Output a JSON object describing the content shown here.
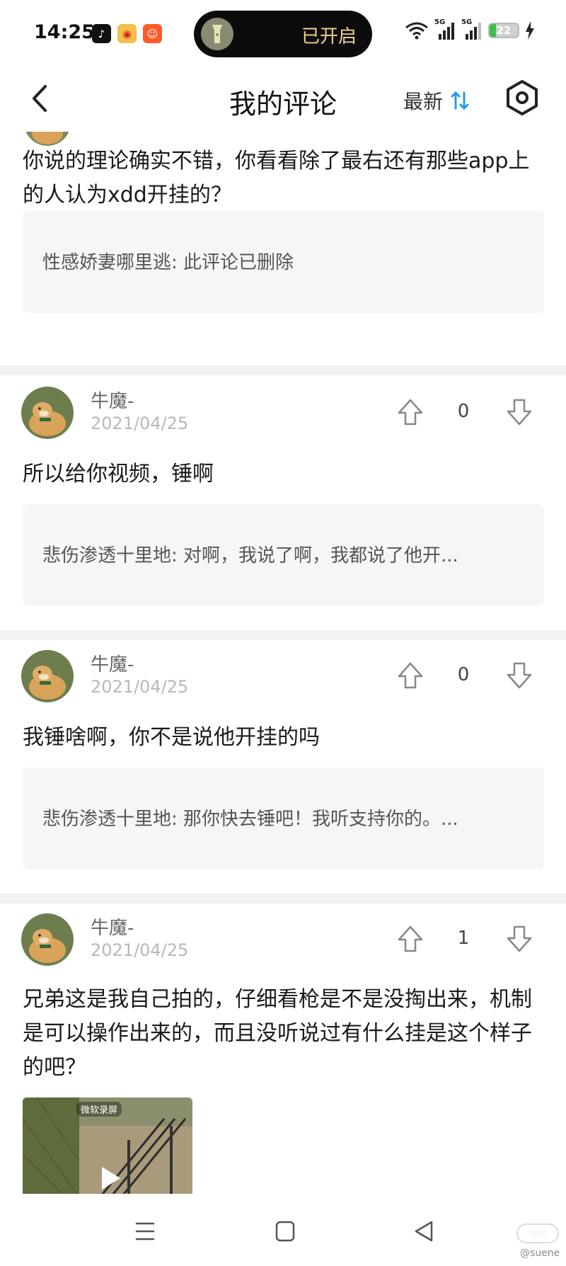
{
  "status_bar": {
    "time": "14:25",
    "flashlight_status": "已开启",
    "battery_level": "22",
    "network_1": "5G",
    "network_2": "5G"
  },
  "header": {
    "title": "我的评论",
    "sort_label": "最新"
  },
  "comments": [
    {
      "text": "你说的理论确实不错，你看看除了最右还有那些app上的人认为xdd开挂的？",
      "quote": "性感娇妻哪里逃: 此评论已删除"
    },
    {
      "username": "牛魔-",
      "date": "2021/04/25",
      "votes": "0",
      "text": "所以给你视频，锤啊",
      "quote": "悲伤渗透十里地: 对啊，我说了啊，我都说了他开..."
    },
    {
      "username": "牛魔-",
      "date": "2021/04/25",
      "votes": "0",
      "text": "我锤啥啊，你不是说他开挂的吗",
      "quote": "悲伤渗透十里地: 那你快去锤吧！我听支持你的。..."
    },
    {
      "username": "牛魔-",
      "date": "2021/04/25",
      "votes": "1",
      "text": "兄弟这是我自己拍的，仔细看枪是不是没掏出来，机制是可以操作出来的，而且没听说过有什么挂是这个样子的吧？",
      "video_label": "微软录屏"
    }
  ],
  "watermark": "@suene",
  "colors": {
    "accent": "#1e9bf0",
    "quote_bg": "#f6f6f6",
    "divider": "#f2f2f2",
    "flashlight_text": "#f1d28e"
  }
}
